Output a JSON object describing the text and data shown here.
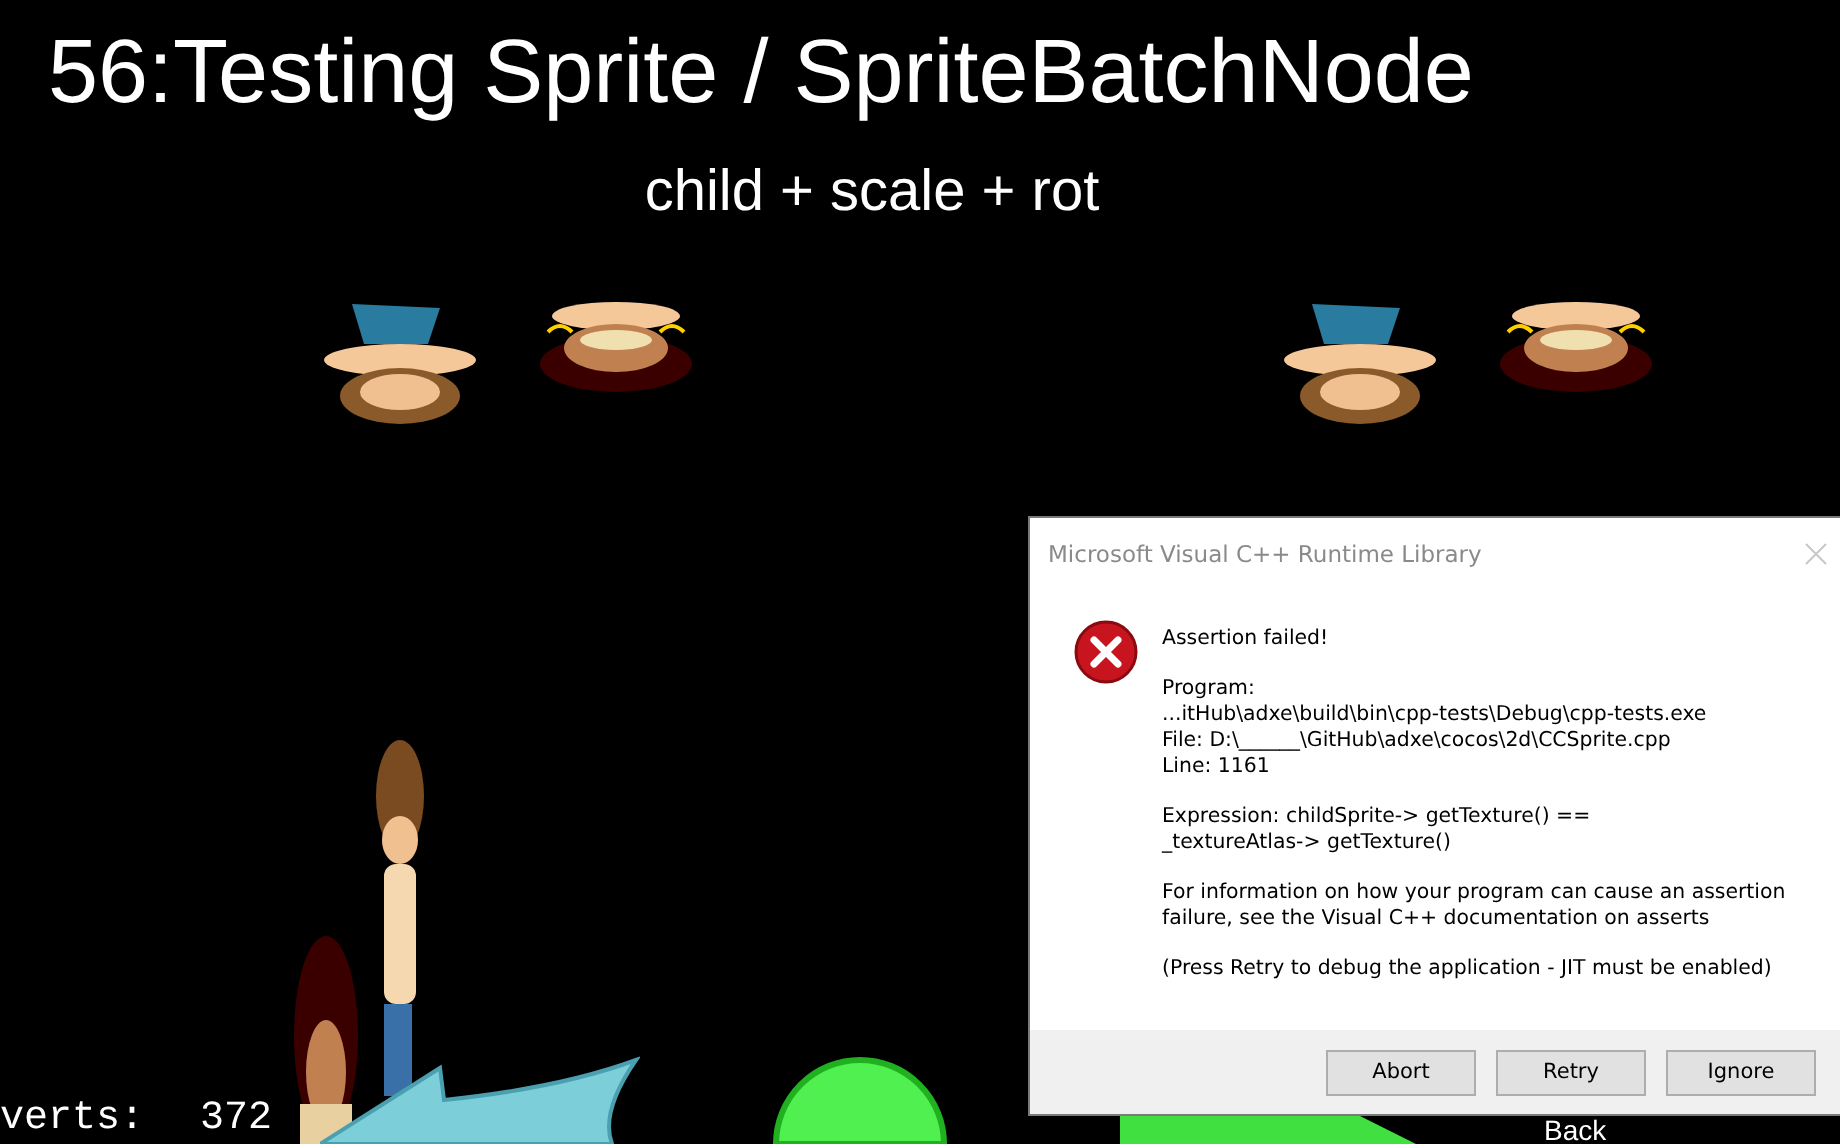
{
  "scene": {
    "title": "56:Testing Sprite / SpriteBatchNode",
    "subtitle": "child + scale + rot",
    "stats": {
      "label": "verts:",
      "value": "372"
    },
    "back_label": "Back"
  },
  "dialog": {
    "title": "Microsoft Visual C++ Runtime Library",
    "paragraphs": [
      "Assertion failed!",
      "Program:\n...itHub\\adxe\\build\\bin\\cpp-tests\\Debug\\cpp-tests.exe\nFile: D:\\______\\GitHub\\adxe\\cocos\\2d\\CCSprite.cpp\nLine: 1161",
      "Expression: childSprite-> getTexture() ==\n_textureAtlas-> getTexture()",
      "For information on how your program can cause an assertion\nfailure, see the Visual C++ documentation on asserts",
      "(Press Retry to debug the application - JIT must be enabled)"
    ],
    "buttons": [
      {
        "label": "Abort"
      },
      {
        "label": "Retry"
      },
      {
        "label": "Ignore"
      }
    ]
  }
}
